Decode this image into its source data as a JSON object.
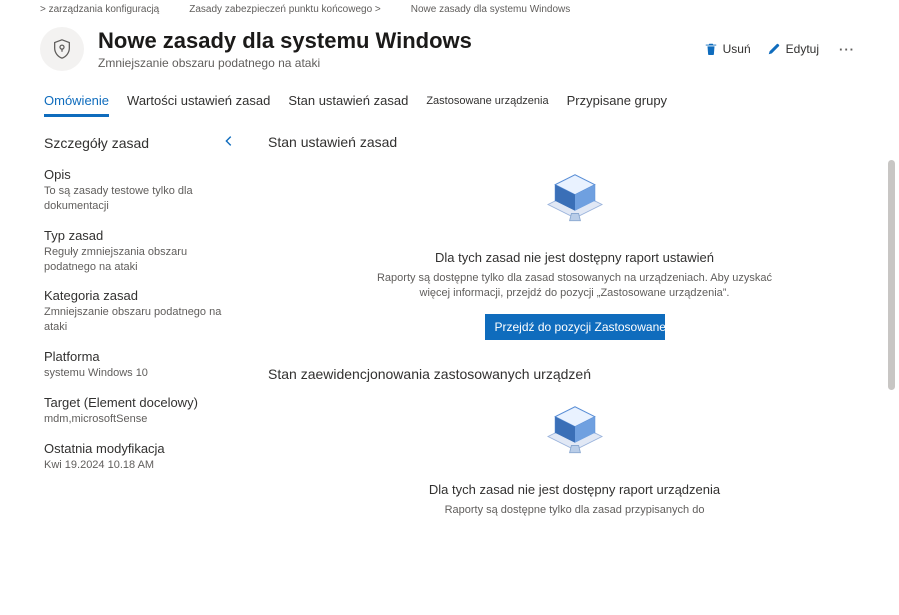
{
  "breadcrumb": {
    "item1": "> zarządzania konfiguracją",
    "item2": "Zasady zabezpieczeń punktu końcowego >",
    "item3": "Nowe zasady dla systemu Windows"
  },
  "header": {
    "title": "Nowe zasady dla systemu Windows",
    "subtitle": "Zmniejszanie obszaru podatnego na ataki",
    "actions": {
      "delete": "Usuń",
      "edit": "Edytuj"
    }
  },
  "tabs": {
    "overview": "Omówienie",
    "settingsValues": "Wartości ustawień zasad",
    "settingsStatus": "Stan ustawień zasad",
    "appliedDevices": "Zastosowane urządzenia",
    "assignedGroups": "Przypisane grupy"
  },
  "side": {
    "title": "Szczegóły zasad",
    "fields": {
      "descLabel": "Opis",
      "descValue": "To są zasady testowe tylko dla dokumentacji",
      "typeLabel": "Typ zasad",
      "typeValue": "Reguły zmniejszania obszaru podatnego na ataki",
      "catLabel": "Kategoria zasad",
      "catValue": "Zmniejszanie obszaru podatnego na ataki",
      "platLabel": "Platforma",
      "platValue": "systemu Windows 10",
      "targetLabel": "Target (Element docelowy)",
      "targetValue": "mdm,microsoftSense",
      "modLabel": "Ostatnia modyfikacja",
      "modValue": "Kwi 19.2024 10.18 AM"
    }
  },
  "main": {
    "card1": {
      "title": "Stan ustawień zasad",
      "msgTitle": "Dla tych zasad nie jest dostępny raport ustawień",
      "msgBody": "Raporty są dostępne tylko dla zasad stosowanych na urządzeniach. Aby uzyskać więcej informacji, przejdź do pozycji „Zastosowane urządzenia”.",
      "btn": "Przejdź do pozycji Zastosowane urządzenia"
    },
    "card2": {
      "title": "Stan zaewidencjonowania zastosowanych urządzeń",
      "msgTitle": "Dla tych zasad nie jest dostępny raport urządzenia",
      "msgBody": "Raporty są dostępne tylko dla zasad przypisanych do"
    }
  }
}
